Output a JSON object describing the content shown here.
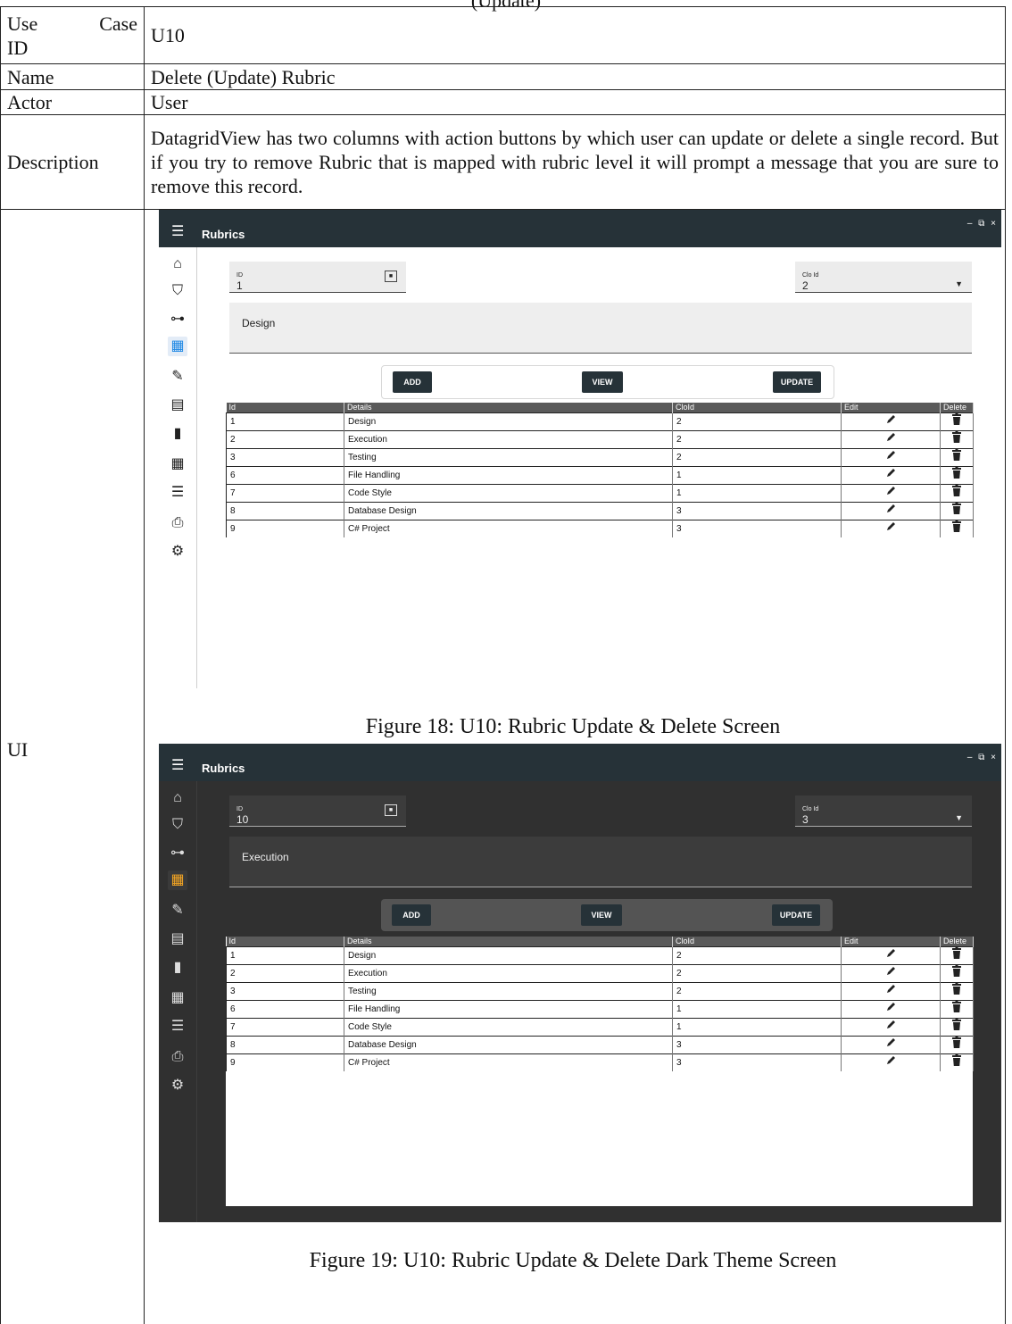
{
  "header_cut": "(Update)",
  "usecase": {
    "id_label": [
      "Use",
      "Case",
      "ID"
    ],
    "id_value": "U10",
    "name_label": "Name",
    "name_value": "Delete (Update) Rubric",
    "actor_label": "Actor",
    "actor_value": "User",
    "desc_label": "Description",
    "desc_value": "DatagridView has two columns with action buttons by which user can update or delete a single record. But if you try to remove Rubric that is mapped with rubric level it will prompt a message that you are sure to remove this record.",
    "ui_label": "UI"
  },
  "apps": [
    {
      "theme": "light",
      "title": "Rubrics",
      "window_controls": "– ⧉ ×",
      "id_label": "ID",
      "id_value": "1",
      "clo_label": "Clo Id",
      "clo_value": "2",
      "details_value": "Design",
      "buttons": {
        "add": "ADD",
        "view": "VIEW",
        "update": "UPDATE"
      },
      "caption": "Figure 18: U10: Rubric Update & Delete Screen"
    },
    {
      "theme": "dark",
      "title": "Rubrics",
      "window_controls": "– ⧉ ×",
      "id_label": "ID",
      "id_value": "10",
      "clo_label": "Clo Id",
      "clo_value": "3",
      "details_value": "Execution",
      "buttons": {
        "add": "ADD",
        "view": "VIEW",
        "update": "UPDATE"
      },
      "caption": "Figure 19: U10: Rubric Update & Delete Dark Theme Screen"
    }
  ],
  "grid": {
    "columns": [
      "Id",
      "Details",
      "CloId",
      "Edit",
      "Delete"
    ],
    "rows": [
      [
        "1",
        "Design",
        "2"
      ],
      [
        "2",
        "Execution",
        "2"
      ],
      [
        "3",
        "Testing",
        "2"
      ],
      [
        "6",
        "File Handling",
        "1"
      ],
      [
        "7",
        "Code Style",
        "1"
      ],
      [
        "8",
        "Database Design",
        "3"
      ],
      [
        "9",
        "C# Project",
        "3"
      ]
    ]
  },
  "sidebar_icons": [
    "home-icon",
    "graduation-cap-icon",
    "hierarchy-icon",
    "rubric-grid-icon",
    "ruler-icon",
    "assessment-icon",
    "books-icon",
    "calculator-icon",
    "checklist-icon",
    "pdf-printer-icon",
    "settings-icon"
  ],
  "colors": {
    "titlebar": "#263238",
    "button": "#263238",
    "dark_bg": "#303030",
    "grid_header": "#5a5a5a"
  }
}
